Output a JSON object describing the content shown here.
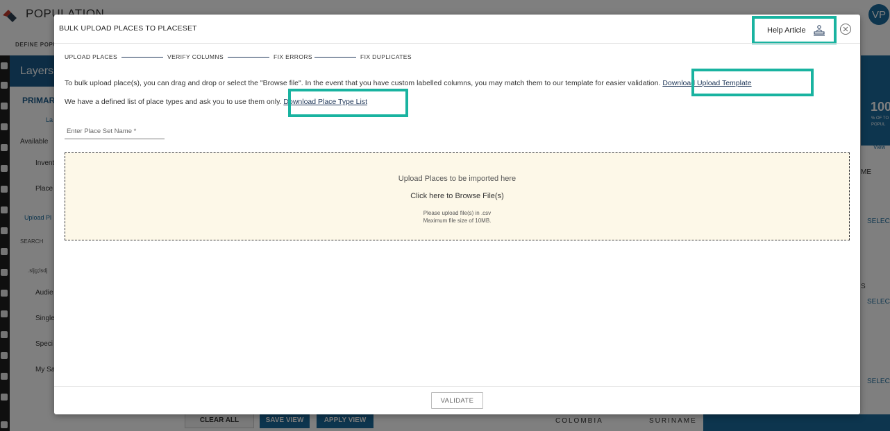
{
  "app": {
    "title": "POPULATION",
    "subtitle": "DEFINE POPU",
    "avatar": "VP",
    "layers_title": "Layers",
    "primary_tab": "PRIMARY",
    "layer_link": "La",
    "available_label": "Available",
    "tree_items": [
      "Invent",
      "Place",
      "Audie",
      "Single",
      "Speci",
      "My Sa"
    ],
    "upload_link": "Upload Pl",
    "search_label": "SEARCH",
    "search_value": ".sljg;lsdj",
    "right_stat": "100",
    "right_stat_sub1": "% OF TO",
    "right_stat_sub2": "POPUL",
    "right_view": "View",
    "right_me": "ME",
    "right_s": "S",
    "right_select": "SELEC",
    "bottom_buttons": {
      "clear": "CLEAR ALL",
      "save": "SAVE VIEW",
      "apply": "APPLY VIEW"
    },
    "map_labels": [
      "COLOMBIA",
      "SURINAME"
    ]
  },
  "modal": {
    "title": "BULK UPLOAD PLACES TO PLACESET",
    "help_label": "Help Article",
    "steps": [
      "UPLOAD PLACES",
      "VERIFY COLUMNS",
      "FIX ERRORS",
      "FIX DUPLICATES"
    ],
    "desc1": "To bulk upload place(s), you can drag and drop or select the \"Browse file\". In the event that you have custom labelled columns, you may match them to our template for easier validation.",
    "download_template": "Download Upload Template",
    "desc2": "We have a defined list of place types and ask you to use them only.",
    "download_types": "Download Place Type List",
    "name_placeholder": "Enter Place Set Name *",
    "dropzone": {
      "title": "Upload Places to be imported here",
      "browse": "Click here to Browse File(s)",
      "note1": "Please upload file(s) in .csv",
      "note2": "Maximum file size of 10MB."
    },
    "validate_label": "VALIDATE"
  },
  "colors": {
    "highlight": "#19b3a0",
    "primary": "#1a5b8a",
    "link": "#1d3557",
    "dropzone_bg": "#fdf8e8"
  }
}
